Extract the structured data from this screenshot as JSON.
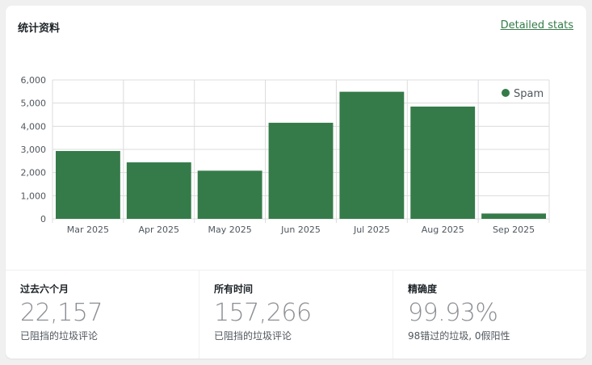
{
  "card": {
    "title": "统计资料",
    "detail_link": "Detailed stats"
  },
  "colors": {
    "bar": "#357b49",
    "grid": "#dcdcde",
    "link": "#357b49"
  },
  "chart_data": {
    "type": "bar",
    "categories": [
      "Mar 2025",
      "Apr 2025",
      "May 2025",
      "Jun 2025",
      "Jul 2025",
      "Aug 2025",
      "Sep 2025"
    ],
    "series": [
      {
        "name": "Spam",
        "values": [
          2930,
          2440,
          2080,
          4150,
          5490,
          4850,
          230
        ]
      }
    ],
    "ylim": [
      0,
      6000
    ],
    "yticks": [
      0,
      1000,
      2000,
      3000,
      4000,
      5000,
      6000
    ],
    "ytick_labels": [
      "0",
      "1,000",
      "2,000",
      "3,000",
      "4,000",
      "5,000",
      "6,000"
    ],
    "legend": "top-right",
    "grid": true
  },
  "stats": [
    {
      "label": "过去六个月",
      "value": "22,157",
      "desc": "已阻挡的垃圾评论"
    },
    {
      "label": "所有时间",
      "value": "157,266",
      "desc": "已阻挡的垃圾评论"
    },
    {
      "label": "精确度",
      "value": "99.93%",
      "desc": "98错过的垃圾, 0假阳性"
    }
  ]
}
